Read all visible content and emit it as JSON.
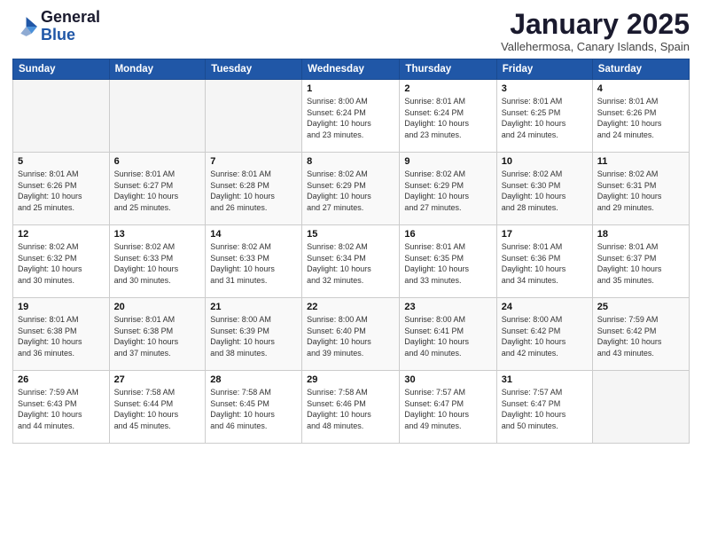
{
  "header": {
    "logo_general": "General",
    "logo_blue": "Blue",
    "month": "January 2025",
    "location": "Vallehermosa, Canary Islands, Spain"
  },
  "weekdays": [
    "Sunday",
    "Monday",
    "Tuesday",
    "Wednesday",
    "Thursday",
    "Friday",
    "Saturday"
  ],
  "weeks": [
    [
      {
        "day": "",
        "info": ""
      },
      {
        "day": "",
        "info": ""
      },
      {
        "day": "",
        "info": ""
      },
      {
        "day": "1",
        "info": "Sunrise: 8:00 AM\nSunset: 6:24 PM\nDaylight: 10 hours\nand 23 minutes."
      },
      {
        "day": "2",
        "info": "Sunrise: 8:01 AM\nSunset: 6:24 PM\nDaylight: 10 hours\nand 23 minutes."
      },
      {
        "day": "3",
        "info": "Sunrise: 8:01 AM\nSunset: 6:25 PM\nDaylight: 10 hours\nand 24 minutes."
      },
      {
        "day": "4",
        "info": "Sunrise: 8:01 AM\nSunset: 6:26 PM\nDaylight: 10 hours\nand 24 minutes."
      }
    ],
    [
      {
        "day": "5",
        "info": "Sunrise: 8:01 AM\nSunset: 6:26 PM\nDaylight: 10 hours\nand 25 minutes."
      },
      {
        "day": "6",
        "info": "Sunrise: 8:01 AM\nSunset: 6:27 PM\nDaylight: 10 hours\nand 25 minutes."
      },
      {
        "day": "7",
        "info": "Sunrise: 8:01 AM\nSunset: 6:28 PM\nDaylight: 10 hours\nand 26 minutes."
      },
      {
        "day": "8",
        "info": "Sunrise: 8:02 AM\nSunset: 6:29 PM\nDaylight: 10 hours\nand 27 minutes."
      },
      {
        "day": "9",
        "info": "Sunrise: 8:02 AM\nSunset: 6:29 PM\nDaylight: 10 hours\nand 27 minutes."
      },
      {
        "day": "10",
        "info": "Sunrise: 8:02 AM\nSunset: 6:30 PM\nDaylight: 10 hours\nand 28 minutes."
      },
      {
        "day": "11",
        "info": "Sunrise: 8:02 AM\nSunset: 6:31 PM\nDaylight: 10 hours\nand 29 minutes."
      }
    ],
    [
      {
        "day": "12",
        "info": "Sunrise: 8:02 AM\nSunset: 6:32 PM\nDaylight: 10 hours\nand 30 minutes."
      },
      {
        "day": "13",
        "info": "Sunrise: 8:02 AM\nSunset: 6:33 PM\nDaylight: 10 hours\nand 30 minutes."
      },
      {
        "day": "14",
        "info": "Sunrise: 8:02 AM\nSunset: 6:33 PM\nDaylight: 10 hours\nand 31 minutes."
      },
      {
        "day": "15",
        "info": "Sunrise: 8:02 AM\nSunset: 6:34 PM\nDaylight: 10 hours\nand 32 minutes."
      },
      {
        "day": "16",
        "info": "Sunrise: 8:01 AM\nSunset: 6:35 PM\nDaylight: 10 hours\nand 33 minutes."
      },
      {
        "day": "17",
        "info": "Sunrise: 8:01 AM\nSunset: 6:36 PM\nDaylight: 10 hours\nand 34 minutes."
      },
      {
        "day": "18",
        "info": "Sunrise: 8:01 AM\nSunset: 6:37 PM\nDaylight: 10 hours\nand 35 minutes."
      }
    ],
    [
      {
        "day": "19",
        "info": "Sunrise: 8:01 AM\nSunset: 6:38 PM\nDaylight: 10 hours\nand 36 minutes."
      },
      {
        "day": "20",
        "info": "Sunrise: 8:01 AM\nSunset: 6:38 PM\nDaylight: 10 hours\nand 37 minutes."
      },
      {
        "day": "21",
        "info": "Sunrise: 8:00 AM\nSunset: 6:39 PM\nDaylight: 10 hours\nand 38 minutes."
      },
      {
        "day": "22",
        "info": "Sunrise: 8:00 AM\nSunset: 6:40 PM\nDaylight: 10 hours\nand 39 minutes."
      },
      {
        "day": "23",
        "info": "Sunrise: 8:00 AM\nSunset: 6:41 PM\nDaylight: 10 hours\nand 40 minutes."
      },
      {
        "day": "24",
        "info": "Sunrise: 8:00 AM\nSunset: 6:42 PM\nDaylight: 10 hours\nand 42 minutes."
      },
      {
        "day": "25",
        "info": "Sunrise: 7:59 AM\nSunset: 6:42 PM\nDaylight: 10 hours\nand 43 minutes."
      }
    ],
    [
      {
        "day": "26",
        "info": "Sunrise: 7:59 AM\nSunset: 6:43 PM\nDaylight: 10 hours\nand 44 minutes."
      },
      {
        "day": "27",
        "info": "Sunrise: 7:58 AM\nSunset: 6:44 PM\nDaylight: 10 hours\nand 45 minutes."
      },
      {
        "day": "28",
        "info": "Sunrise: 7:58 AM\nSunset: 6:45 PM\nDaylight: 10 hours\nand 46 minutes."
      },
      {
        "day": "29",
        "info": "Sunrise: 7:58 AM\nSunset: 6:46 PM\nDaylight: 10 hours\nand 48 minutes."
      },
      {
        "day": "30",
        "info": "Sunrise: 7:57 AM\nSunset: 6:47 PM\nDaylight: 10 hours\nand 49 minutes."
      },
      {
        "day": "31",
        "info": "Sunrise: 7:57 AM\nSunset: 6:47 PM\nDaylight: 10 hours\nand 50 minutes."
      },
      {
        "day": "",
        "info": ""
      }
    ]
  ]
}
